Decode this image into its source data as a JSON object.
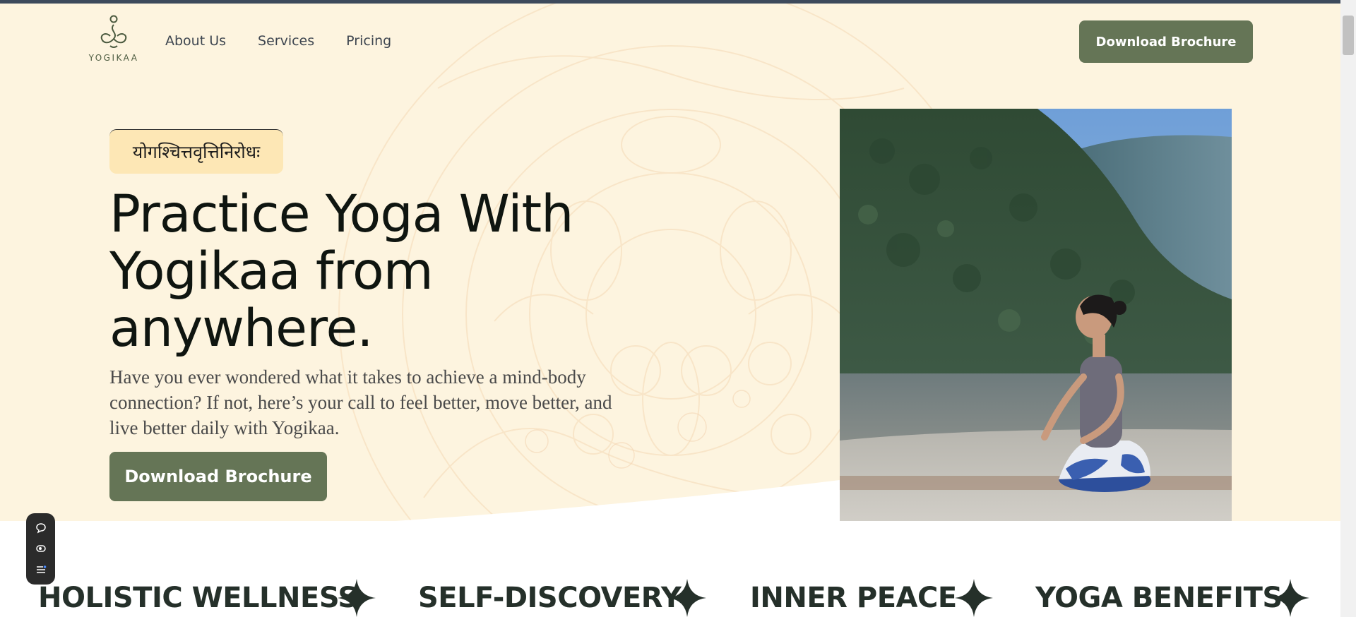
{
  "brand": {
    "name": "YOGIKAA"
  },
  "nav": {
    "items": [
      {
        "label": "About Us"
      },
      {
        "label": "Services"
      },
      {
        "label": "Pricing"
      }
    ]
  },
  "header": {
    "cta_label": "Download Brochure"
  },
  "hero": {
    "badge": "योगश्चित्तवृत्तिनिरोधः",
    "headline_line1": "Practice Yoga With",
    "headline_line2": "Yogikaa from",
    "headline_line3": "anywhere.",
    "subtext": "Have you ever wondered what it takes to achieve a mind-body connection? If not, here’s your call to feel better, move better, and live better daily with Yogikaa.",
    "cta_label": "Download Brochure"
  },
  "ticker": {
    "items": [
      {
        "label": "HOLISTIC WELLNESS"
      },
      {
        "label": "SELF-DISCOVERY"
      },
      {
        "label": "INNER PEACE"
      },
      {
        "label": "YOGA BENEFITS"
      }
    ]
  },
  "chat_widget": {
    "icons": [
      "chat-bubble-icon",
      "eye-icon",
      "menu-icon"
    ]
  },
  "colors": {
    "accent": "#657556",
    "hero_bg": "#fdf4df",
    "badge_bg": "#fde7b5",
    "text_dark": "#0f1510"
  }
}
